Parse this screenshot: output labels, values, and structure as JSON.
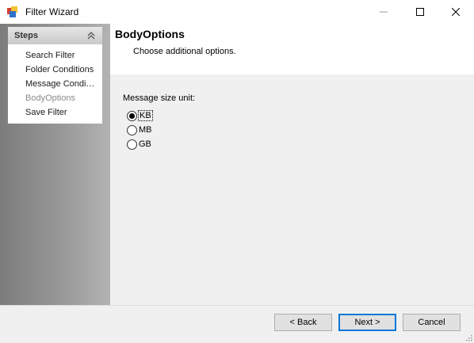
{
  "window": {
    "title": "Filter Wizard"
  },
  "steps": {
    "title": "Steps",
    "items": [
      {
        "label": "Search Filter",
        "active": false
      },
      {
        "label": "Folder Conditions",
        "active": false
      },
      {
        "label": "Message Condi…",
        "active": false
      },
      {
        "label": "BodyOptions",
        "active": true
      },
      {
        "label": "Save Filter",
        "active": false
      }
    ]
  },
  "header": {
    "title": "BodyOptions",
    "subtitle": "Choose additional options."
  },
  "options": {
    "group_label": "Message size unit:",
    "choices": [
      {
        "label": "KB",
        "selected": true
      },
      {
        "label": "MB",
        "selected": false
      },
      {
        "label": "GB",
        "selected": false
      }
    ]
  },
  "buttons": {
    "back": "< Back",
    "next": "Next >",
    "cancel": "Cancel"
  },
  "colors": {
    "accent": "#0078d7",
    "panel_dark": "#7c7c7c",
    "panel_light": "#b3b3b3"
  }
}
